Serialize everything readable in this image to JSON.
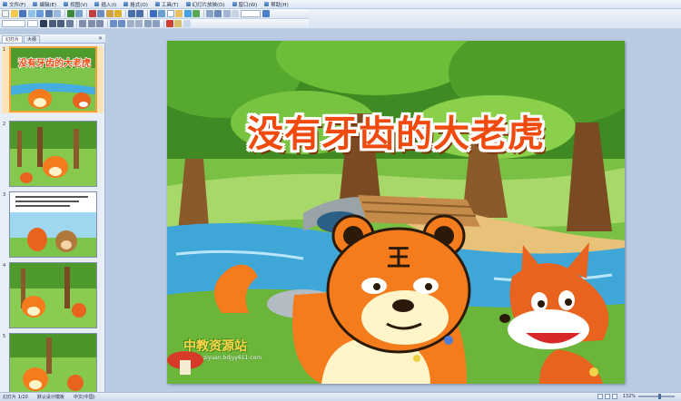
{
  "menubar": {
    "items": [
      {
        "label": "文件(F)",
        "icon": "file-icon"
      },
      {
        "label": "编辑(E)",
        "icon": "edit-icon"
      },
      {
        "label": "视图(V)",
        "icon": "view-icon"
      },
      {
        "label": "插入(I)",
        "icon": "insert-icon"
      },
      {
        "label": "格式(O)",
        "icon": "format-icon"
      },
      {
        "label": "工具(T)",
        "icon": "tools-icon"
      },
      {
        "label": "幻灯片放映(D)",
        "icon": "slideshow-icon"
      },
      {
        "label": "窗口(W)",
        "icon": "window-icon"
      },
      {
        "label": "帮助(H)",
        "icon": "help-icon"
      }
    ]
  },
  "pane": {
    "tabs": [
      {
        "label": "幻灯片"
      },
      {
        "label": "大纲"
      }
    ],
    "close_icon": "close-icon",
    "thumbnails": [
      {
        "number": "1"
      },
      {
        "number": "2"
      },
      {
        "number": "3"
      },
      {
        "number": "4"
      },
      {
        "number": "5"
      }
    ]
  },
  "slide": {
    "title": "没有牙齿的大老虎",
    "watermark": "中教资源站",
    "watermark_url": "ziyuan.bdjyy611.com"
  },
  "statusbar": {
    "slide_counter": "幻灯片 1/20",
    "design": "默认设计模板",
    "language": "中文(中国)",
    "zoom": "132%"
  },
  "colors": {
    "title": "#f04a0e",
    "grass": "#5aa52f",
    "river": "#3fa6d8",
    "tiger": "#f47c1c",
    "fox": "#e8641e",
    "selected_thumb_border": "#f2a23a"
  }
}
